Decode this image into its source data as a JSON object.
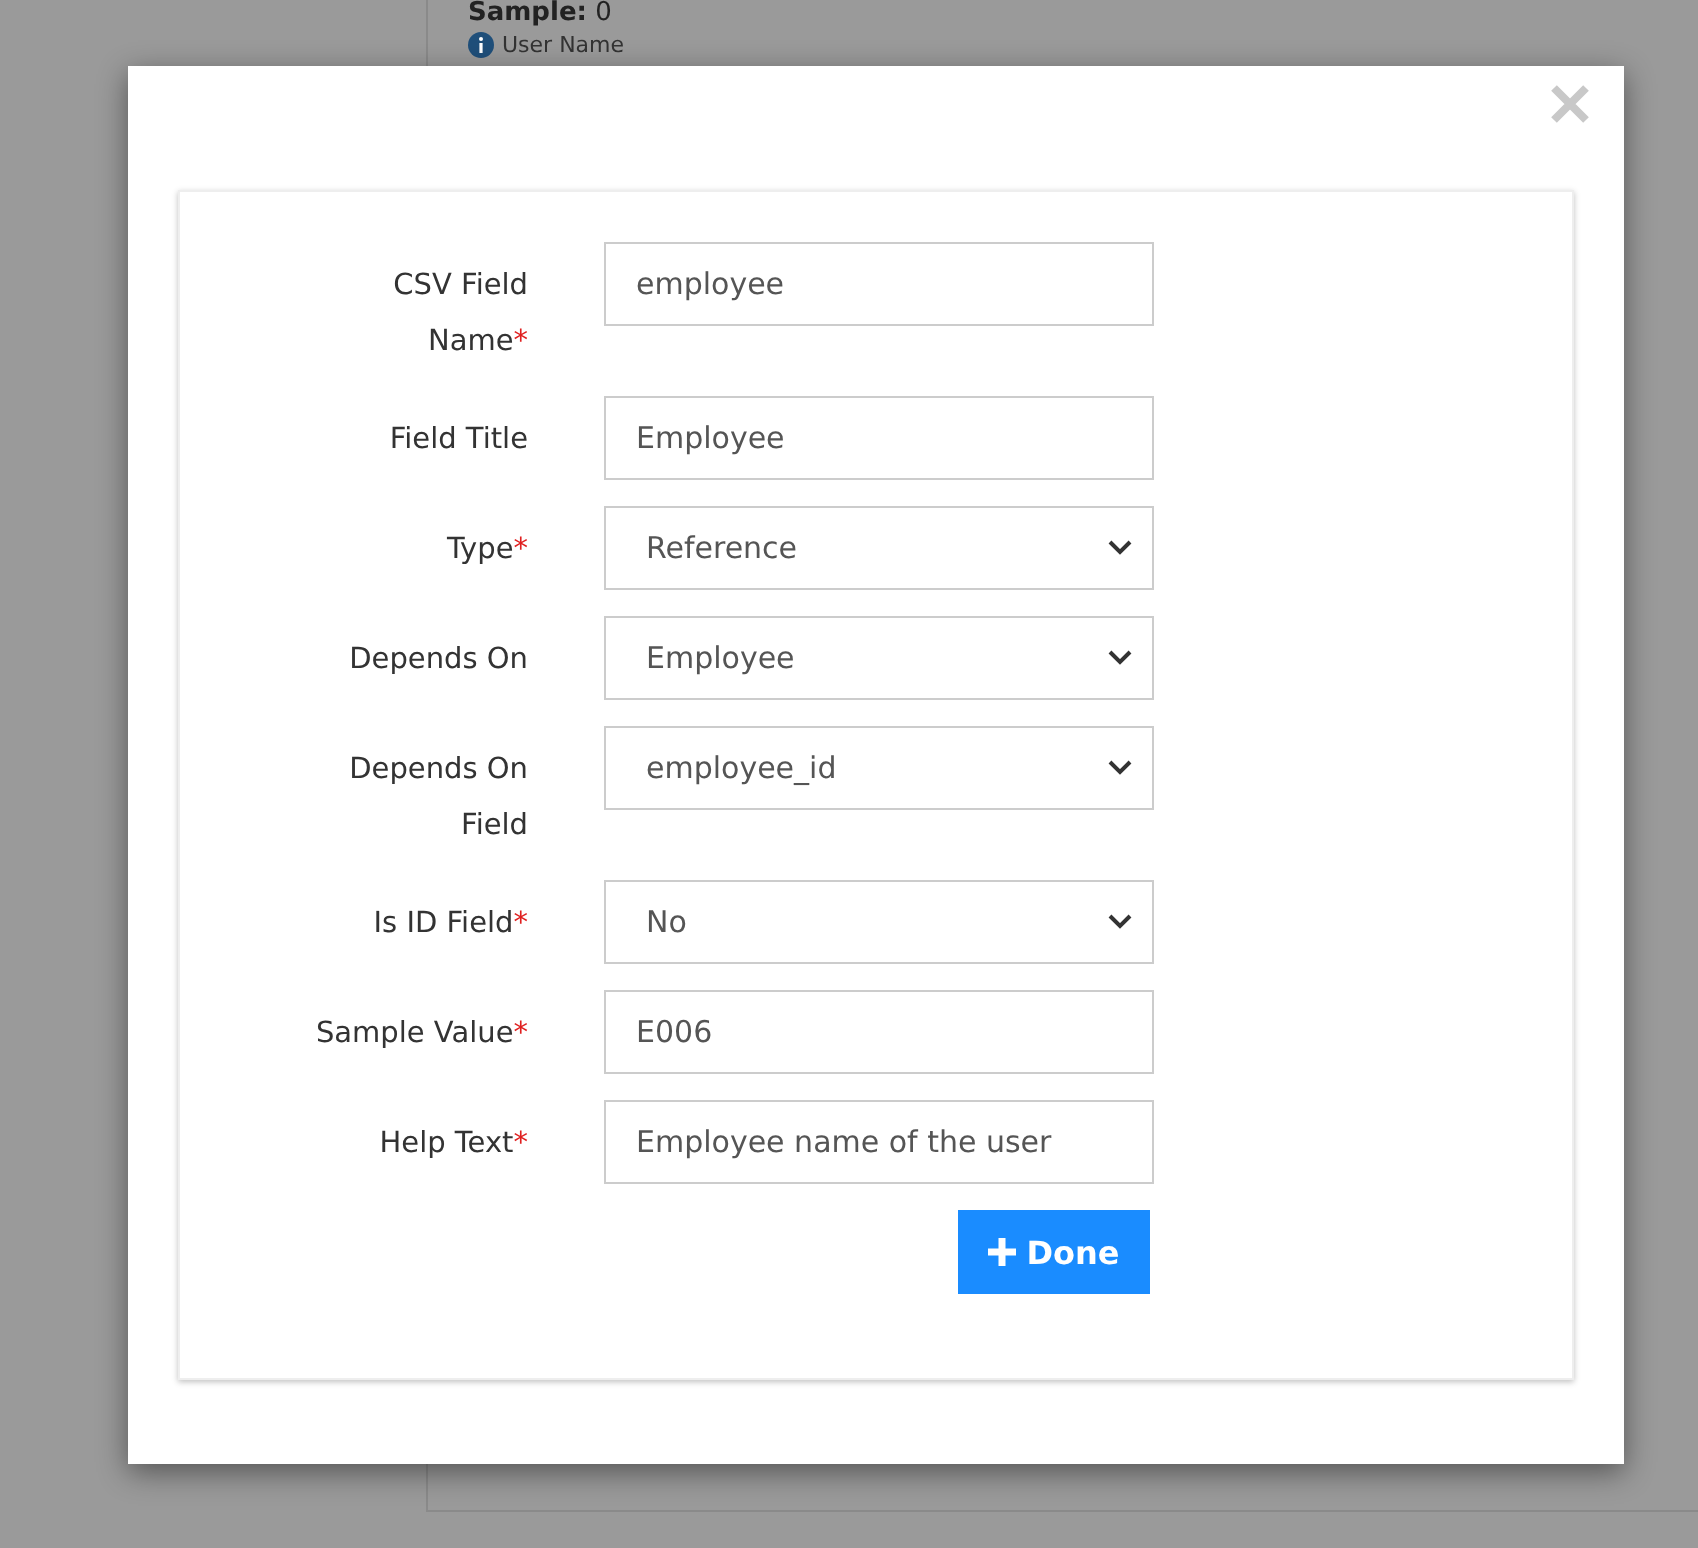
{
  "background": {
    "heading": "**Sample:** 0",
    "hint": "User Name"
  },
  "dialog": {
    "fields": [
      {
        "label": "CSV Field Name",
        "required": true,
        "kind": "text",
        "value": "employee"
      },
      {
        "label": "Field Title",
        "required": false,
        "kind": "text",
        "value": "Employee"
      },
      {
        "label": "Type",
        "required": true,
        "kind": "select",
        "value": "Reference"
      },
      {
        "label": "Depends On",
        "required": false,
        "kind": "select",
        "value": "Employee"
      },
      {
        "label": "Depends On Field",
        "required": false,
        "kind": "select",
        "value": "employee_id"
      },
      {
        "label": "Is ID Field",
        "required": true,
        "kind": "select",
        "value": "No"
      },
      {
        "label": "Sample Value",
        "required": true,
        "kind": "text",
        "value": "E006"
      },
      {
        "label": "Help Text",
        "required": true,
        "kind": "text",
        "value": "Employee name of the user"
      }
    ],
    "required_mark": "*",
    "button": "Done"
  }
}
